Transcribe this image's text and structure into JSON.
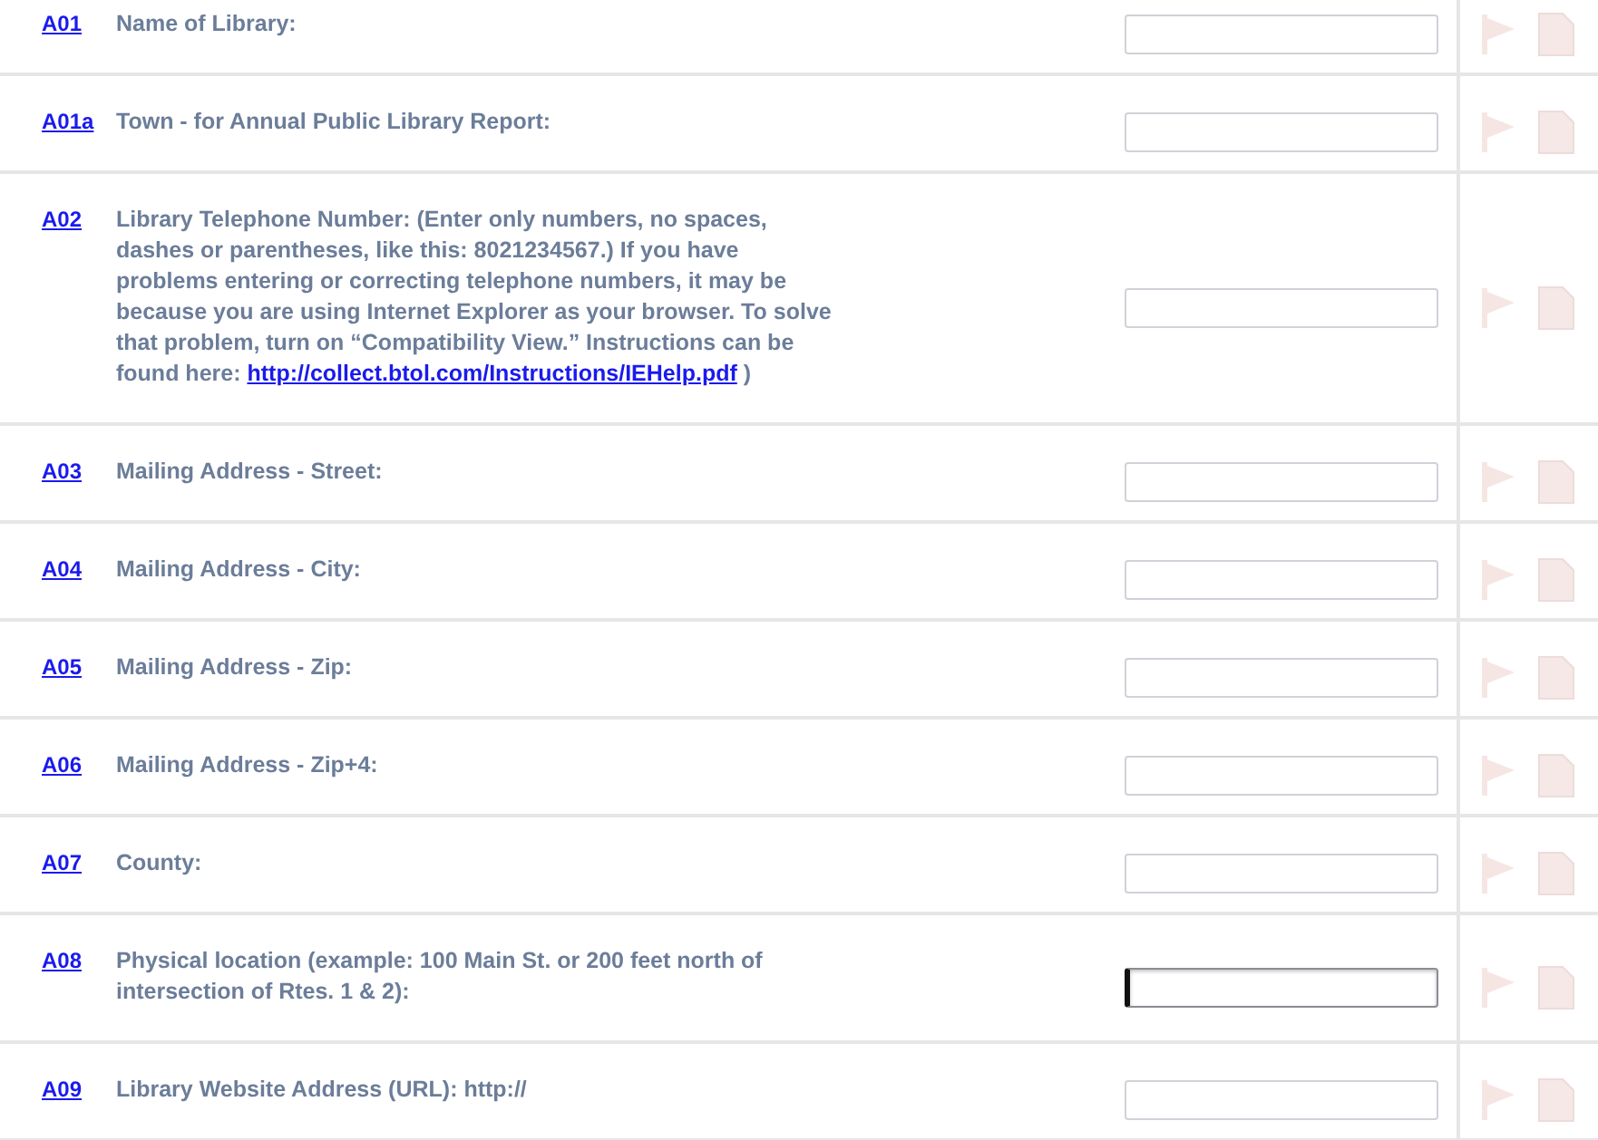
{
  "questions": [
    {
      "code": "A01",
      "label": "Name of Library:",
      "focused": false
    },
    {
      "code": "A01a",
      "label": "Town - for Annual Public Library Report:",
      "focused": false
    },
    {
      "code": "A02",
      "label": "Library Telephone Number: (Enter only numbers, no spaces, dashes or parentheses, like this: 8021234567.) If you have problems entering or correcting telephone numbers, it may be because you are using Internet Explorer as your browser. To solve that problem, turn on “Compatibility View.” Instructions can be found here:",
      "link": "http://collect.btol.com/Instructions/IEHelp.pdf",
      "label_end": ")",
      "focused": false
    },
    {
      "code": "A03",
      "label": "Mailing Address - Street:",
      "focused": false
    },
    {
      "code": "A04",
      "label": "Mailing Address - City:",
      "focused": false
    },
    {
      "code": "A05",
      "label": "Mailing Address - Zip:",
      "focused": false
    },
    {
      "code": "A06",
      "label": "Mailing Address - Zip+4:",
      "focused": false
    },
    {
      "code": "A07",
      "label": "County:",
      "focused": false
    },
    {
      "code": "A08",
      "label": "Physical location (example: 100 Main St. or 200 feet north of intersection of Rtes. 1 & 2):",
      "focused": true
    },
    {
      "code": "A09",
      "label": "Library Website Address (URL): http://",
      "focused": false
    }
  ]
}
